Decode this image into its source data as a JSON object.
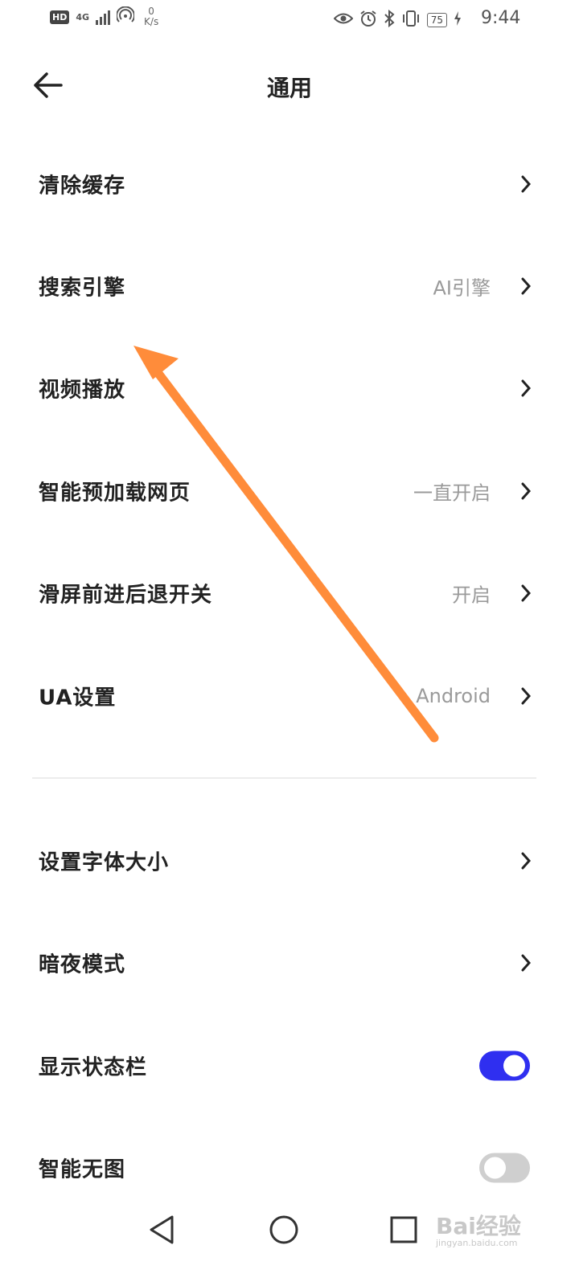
{
  "status_bar": {
    "hd_label": "HD",
    "network_label": "4G",
    "speed_value": "0",
    "speed_unit": "K/s",
    "battery": "75",
    "time": "9:44"
  },
  "header": {
    "title": "通用"
  },
  "settings": [
    {
      "label": "清除缓存",
      "value": ""
    },
    {
      "label": "搜索引擎",
      "value": "AI引擎"
    },
    {
      "label": "视频播放",
      "value": ""
    },
    {
      "label": "智能预加载网页",
      "value": "一直开启"
    },
    {
      "label": "滑屏前进后退开关",
      "value": "开启"
    },
    {
      "label": "UA设置",
      "value": "Android"
    }
  ],
  "settings2": [
    {
      "label": "设置字体大小"
    },
    {
      "label": "暗夜模式"
    }
  ],
  "toggles": [
    {
      "label": "显示状态栏",
      "on": true
    },
    {
      "label": "智能无图",
      "on": false
    }
  ],
  "colors": {
    "toggle_on": "#2f2ff0",
    "toggle_off": "#cfcfcf",
    "arrow": "#ff8c3a"
  },
  "watermark": {
    "brand": "Bai经验",
    "url": "jingyan.baidu.com"
  }
}
